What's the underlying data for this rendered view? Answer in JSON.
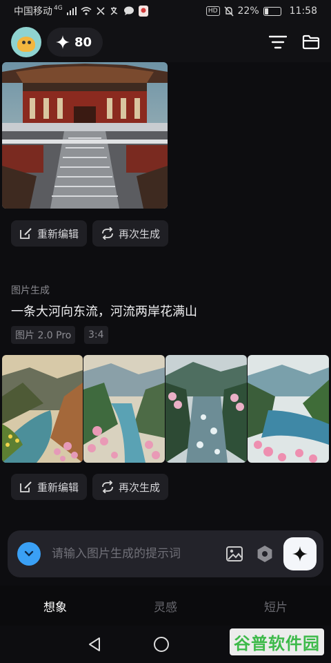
{
  "status_bar": {
    "carrier": "中国移动",
    "network_badge": "4G",
    "hd_badge": "HD",
    "battery_percent": "22%",
    "battery_level": 0.22,
    "time": "11:58"
  },
  "header": {
    "credits": "80",
    "icons": [
      "avatar",
      "sparkle-icon",
      "filter-icon",
      "folder-icon"
    ]
  },
  "first_item": {
    "actions": {
      "edit_label": "重新编辑",
      "regenerate_label": "再次生成"
    }
  },
  "second_item": {
    "section_label": "图片生成",
    "prompt": "一条大河向东流，河流两岸花满山",
    "model_tag": "图片 2.0 Pro",
    "ratio_tag": "3:4",
    "actions": {
      "edit_label": "重新编辑",
      "regenerate_label": "再次生成"
    }
  },
  "input_bar": {
    "placeholder": "请输入图片生成的提示词"
  },
  "bottom_tabs": [
    {
      "label": "想象",
      "active": true
    },
    {
      "label": "灵感",
      "active": false
    },
    {
      "label": "短片",
      "active": false
    }
  ],
  "watermark": "谷普软件园",
  "colors": {
    "accent": "#3aa0f5",
    "background": "#0d0d10",
    "surface": "#1f1f24"
  }
}
